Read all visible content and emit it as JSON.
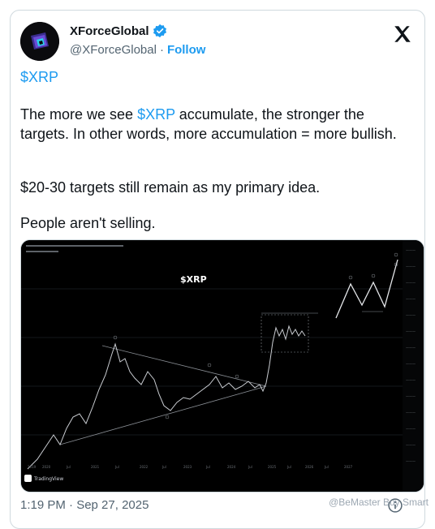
{
  "author": {
    "display_name": "XForceGlobal",
    "handle": "@XForceGlobal",
    "separator": "·",
    "follow_label": "Follow"
  },
  "post": {
    "line_cashtag": "$XRP",
    "p1_a": "The more we see ",
    "p1_cashtag": "$XRP",
    "p1_b": " accumulate, the stronger the targets. In other words, more accumulation = more bullish.",
    "p2": "$20-30 targets still remain as my primary idea.",
    "p3": "People aren't selling."
  },
  "chart_image": {
    "overlay_title": "$XRP",
    "watermark_brand": "TradingView",
    "bottom_year_labels": [
      "2019",
      "2020",
      "Jul",
      "2021",
      "Jul",
      "2022",
      "Jul",
      "2023",
      "Jul",
      "2024",
      "Jul",
      "2025",
      "Jul",
      "2026",
      "Jul",
      "2027"
    ]
  },
  "footer": {
    "timestamp": "1:19 PM · Sep 27, 2025"
  },
  "overlay_watermark": "@BeMaster Buy Smart",
  "colors": {
    "accent": "#1d9bf0",
    "text": "#0f1419",
    "muted": "#536471",
    "border": "#cfd9de"
  }
}
